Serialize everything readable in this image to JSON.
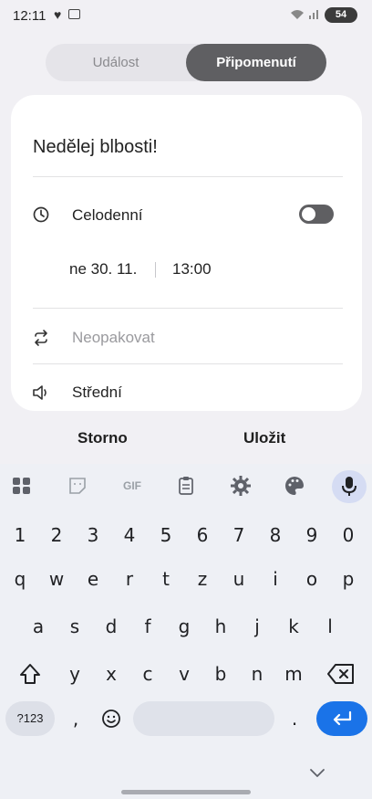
{
  "status_bar": {
    "time": "12:11",
    "battery": "54"
  },
  "tabs": [
    {
      "label": "Událost",
      "selected": false
    },
    {
      "label": "Připomenutí",
      "selected": true
    }
  ],
  "reminder": {
    "title": "Nedělej blbosti!",
    "all_day_label": "Celodenní",
    "all_day_on": false,
    "date": "ne 30. 11.",
    "time": "13:00",
    "repeat": "Neopakovat",
    "volume": "Střední"
  },
  "actions": {
    "cancel": "Storno",
    "save": "Uložit"
  },
  "keyboard": {
    "toolbar": [
      "apps-grid-icon",
      "sticker-icon",
      "GIF",
      "clipboard-icon",
      "gear-icon",
      "palette-icon",
      "mic-icon"
    ],
    "gif_label": "GIF",
    "rows": [
      [
        "1",
        "2",
        "3",
        "4",
        "5",
        "6",
        "7",
        "8",
        "9",
        "0"
      ],
      [
        "q",
        "w",
        "e",
        "r",
        "t",
        "z",
        "u",
        "i",
        "o",
        "p"
      ],
      [
        "a",
        "s",
        "d",
        "f",
        "g",
        "h",
        "j",
        "k",
        "l"
      ],
      [
        "y",
        "x",
        "c",
        "v",
        "b",
        "n",
        "m"
      ]
    ],
    "symbols_label": "?123",
    "comma": ",",
    "period": ".",
    "accent_color": "#1a73e8"
  }
}
